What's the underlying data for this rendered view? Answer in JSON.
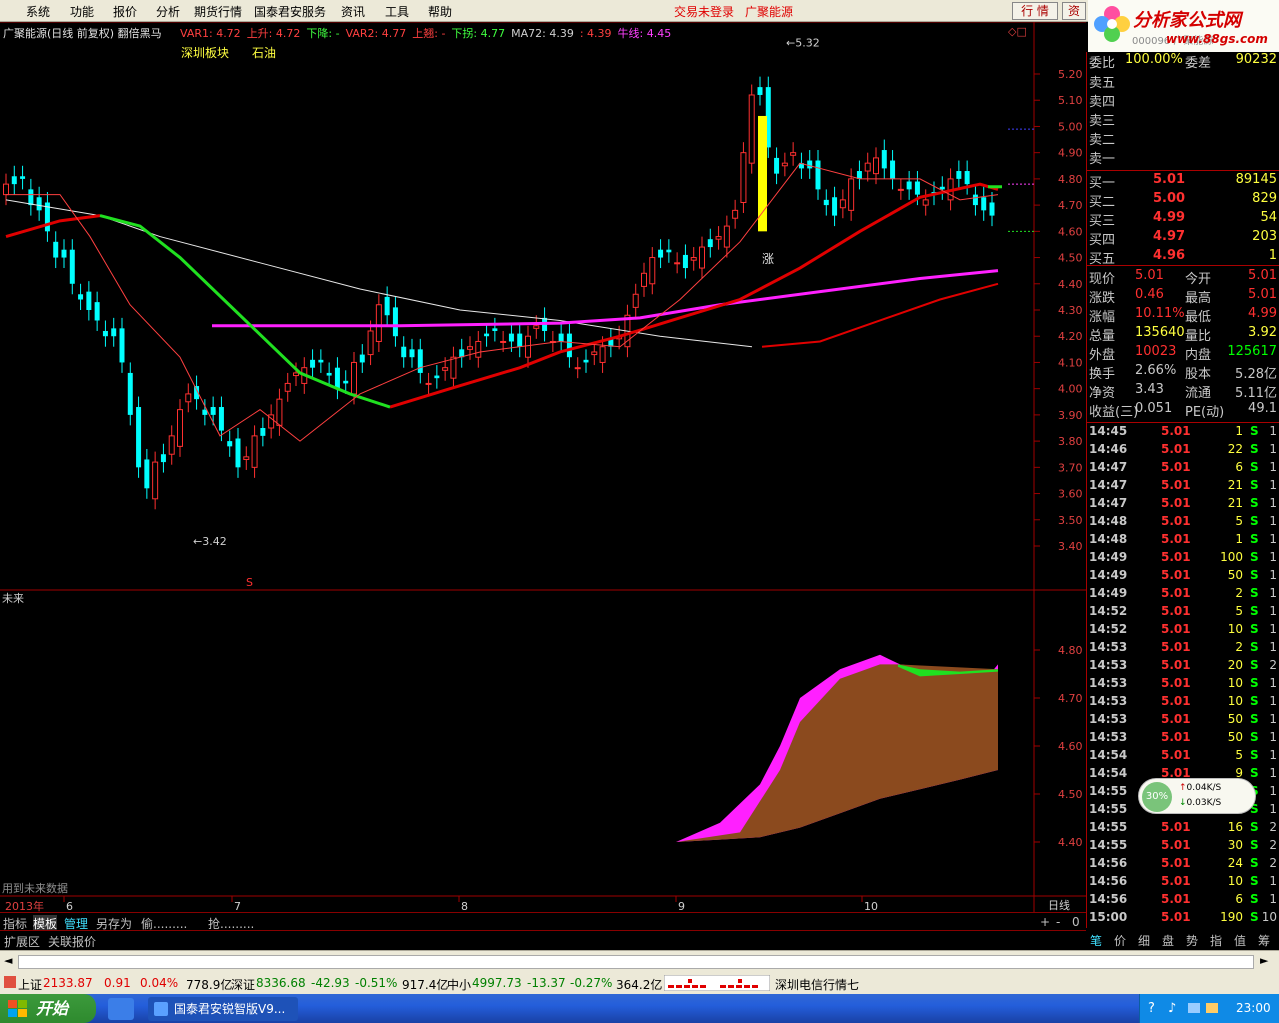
{
  "menu": {
    "items": [
      "系统",
      "功能",
      "报价",
      "分析",
      "期货行情",
      "国泰君安服务",
      "资讯",
      "工具",
      "帮助"
    ],
    "login_status": "交易未登录",
    "stock_link": "广聚能源",
    "btn_quote": "行 情",
    "btn_trade": "资"
  },
  "logo": {
    "title": "分析家公式网",
    "url_text": "www.88gs.com",
    "code_text": "000096 广聚能源"
  },
  "chart": {
    "header_title": "广聚能源(日线 前复权) 翻倍黑马",
    "legend": [
      {
        "label": "VAR1:",
        "value": "4.72",
        "color": "#ff4040"
      },
      {
        "label": "上升:",
        "value": "4.72",
        "color": "#ff4040"
      },
      {
        "label": "下降:",
        "value": "-",
        "color": "#40ff40"
      },
      {
        "label": "VAR2:",
        "value": "4.77",
        "color": "#ff4040"
      },
      {
        "label": "上翘:",
        "value": "-",
        "color": "#ff4040"
      },
      {
        "label": "下拐:",
        "value": "4.77",
        "color": "#40ff40"
      },
      {
        "label": "MA72:",
        "value": "4.39",
        "color": "#d0d0d0"
      },
      {
        "label": ":",
        "value": "4.39",
        "color": "#ff4040"
      },
      {
        "label": "牛线:",
        "value": "4.45",
        "color": "#ff40ff"
      }
    ],
    "tags": [
      "深圳板块",
      "石油"
    ],
    "high_label": "5.32",
    "low_label": "3.42",
    "zhang_label": "涨",
    "s_mark": "S",
    "sub_title": "未来",
    "future_note": "用到未来数据",
    "y_main": [
      "5.20",
      "5.10",
      "5.00",
      "4.90",
      "4.80",
      "4.70",
      "4.60",
      "4.50",
      "4.40",
      "4.30",
      "4.20",
      "4.10",
      "4.00",
      "3.90",
      "3.80",
      "3.70",
      "3.60",
      "3.50",
      "3.40"
    ],
    "y_sub": [
      "4.80",
      "4.70",
      "4.60",
      "4.50",
      "4.40"
    ],
    "x_labels": [
      "2013年",
      "6",
      "7",
      "8",
      "9",
      "10"
    ],
    "period_label": "日线"
  },
  "chart_data": {
    "type": "candlestick",
    "price_range": [
      3.4,
      5.32
    ],
    "high": 5.32,
    "low": 3.42,
    "ma72_last": 4.39,
    "bull_line_last": 4.45,
    "sub_range": [
      4.4,
      4.8
    ]
  },
  "bottom_tabs": [
    "指标",
    "模板",
    "管理",
    "另存为",
    "偷.........",
    "抢........."
  ],
  "ext_tabs": [
    "扩展区",
    "关联报价"
  ],
  "quote": {
    "weibi_label": "委比",
    "weibi": "100.00%",
    "weicha_label": "委差",
    "weicha": "90232",
    "sell": [
      {
        "l": "卖五"
      },
      {
        "l": "卖四"
      },
      {
        "l": "卖三"
      },
      {
        "l": "卖二"
      },
      {
        "l": "卖一"
      }
    ],
    "buy": [
      {
        "l": "买一",
        "p": "5.01",
        "v": "89145"
      },
      {
        "l": "买二",
        "p": "5.00",
        "v": "829"
      },
      {
        "l": "买三",
        "p": "4.99",
        "v": "54"
      },
      {
        "l": "买四",
        "p": "4.97",
        "v": "203"
      },
      {
        "l": "买五",
        "p": "4.96",
        "v": "1"
      }
    ],
    "stats": [
      {
        "a": "现价",
        "av": "5.01",
        "b": "今开",
        "bv": "5.01"
      },
      {
        "a": "涨跌",
        "av": "0.46",
        "b": "最高",
        "bv": "5.01"
      },
      {
        "a": "涨幅",
        "av": "10.11%",
        "b": "最低",
        "bv": "4.99"
      },
      {
        "a": "总量",
        "av": "135640",
        "b": "量比",
        "bv": "3.92"
      },
      {
        "a": "外盘",
        "av": "10023",
        "b": "内盘",
        "bv": "125617"
      },
      {
        "a": "换手",
        "av": "2.66%",
        "b": "股本",
        "bv": "5.28亿"
      },
      {
        "a": "净资",
        "av": "3.43",
        "b": "流通",
        "bv": "5.11亿"
      },
      {
        "a": "收益(三)",
        "av": "0.051",
        "b": "PE(动)",
        "bv": "49.1"
      }
    ],
    "ticks": [
      {
        "t": "14:45",
        "p": "5.01",
        "v": "1",
        "s": "S",
        "n": "1"
      },
      {
        "t": "14:46",
        "p": "5.01",
        "v": "22",
        "s": "S",
        "n": "1"
      },
      {
        "t": "14:47",
        "p": "5.01",
        "v": "6",
        "s": "S",
        "n": "1"
      },
      {
        "t": "14:47",
        "p": "5.01",
        "v": "21",
        "s": "S",
        "n": "1"
      },
      {
        "t": "14:47",
        "p": "5.01",
        "v": "21",
        "s": "S",
        "n": "1"
      },
      {
        "t": "14:48",
        "p": "5.01",
        "v": "5",
        "s": "S",
        "n": "1"
      },
      {
        "t": "14:48",
        "p": "5.01",
        "v": "1",
        "s": "S",
        "n": "1"
      },
      {
        "t": "14:49",
        "p": "5.01",
        "v": "100",
        "s": "S",
        "n": "1"
      },
      {
        "t": "14:49",
        "p": "5.01",
        "v": "50",
        "s": "S",
        "n": "1"
      },
      {
        "t": "14:49",
        "p": "5.01",
        "v": "2",
        "s": "S",
        "n": "1"
      },
      {
        "t": "14:52",
        "p": "5.01",
        "v": "5",
        "s": "S",
        "n": "1"
      },
      {
        "t": "14:52",
        "p": "5.01",
        "v": "10",
        "s": "S",
        "n": "1"
      },
      {
        "t": "14:53",
        "p": "5.01",
        "v": "2",
        "s": "S",
        "n": "1"
      },
      {
        "t": "14:53",
        "p": "5.01",
        "v": "20",
        "s": "S",
        "n": "2"
      },
      {
        "t": "14:53",
        "p": "5.01",
        "v": "10",
        "s": "S",
        "n": "1"
      },
      {
        "t": "14:53",
        "p": "5.01",
        "v": "10",
        "s": "S",
        "n": "1"
      },
      {
        "t": "14:53",
        "p": "5.01",
        "v": "50",
        "s": "S",
        "n": "1"
      },
      {
        "t": "14:53",
        "p": "5.01",
        "v": "50",
        "s": "S",
        "n": "1"
      },
      {
        "t": "14:54",
        "p": "5.01",
        "v": "5",
        "s": "S",
        "n": "1"
      },
      {
        "t": "14:54",
        "p": "5.01",
        "v": "9",
        "s": "S",
        "n": "1"
      },
      {
        "t": "14:55",
        "p": "5.01",
        "v": "",
        "s": "S",
        "n": "1"
      },
      {
        "t": "14:55",
        "p": "5.01",
        "v": "",
        "s": "S",
        "n": "1"
      },
      {
        "t": "14:55",
        "p": "5.01",
        "v": "16",
        "s": "S",
        "n": "2"
      },
      {
        "t": "14:55",
        "p": "5.01",
        "v": "30",
        "s": "S",
        "n": "2"
      },
      {
        "t": "14:56",
        "p": "5.01",
        "v": "24",
        "s": "S",
        "n": "2"
      },
      {
        "t": "14:56",
        "p": "5.01",
        "v": "10",
        "s": "S",
        "n": "1"
      },
      {
        "t": "14:56",
        "p": "5.01",
        "v": "6",
        "s": "S",
        "n": "1"
      },
      {
        "t": "15:00",
        "p": "5.01",
        "v": "190",
        "s": "S",
        "n": "10"
      }
    ],
    "tabs": [
      "笔",
      "价",
      "细",
      "盘",
      "势",
      "指",
      "值",
      "筹"
    ]
  },
  "net": {
    "pct": "30%",
    "up": "0.04K/S",
    "down": "0.03K/S"
  },
  "index_bar": {
    "sh_label": "上证",
    "sh": "2133.87",
    "sh_chg": "0.91",
    "sh_pct": "0.04%",
    "sh_amt": "778.9亿",
    "sz_label": "深证",
    "sz": "8336.68",
    "sz_chg": "-42.93",
    "sz_pct": "-0.51%",
    "sz_amt": "917.4亿",
    "zx_label": "中小",
    "zx": "4997.73",
    "zx_chg": "-13.37",
    "zx_pct": "-0.27%",
    "zx_amt": "364.2亿",
    "ticker": "深圳电信行情七"
  },
  "taskbar": {
    "start": "开始",
    "app": "国泰君安锐智版V9...",
    "time": "23:00"
  },
  "colors": {
    "up": "#ff3030",
    "down": "#00ffff",
    "ma_red": "#e00000",
    "bull": "#ff00ff",
    "green": "#00ff00",
    "quote_yellow": "#ffff00"
  }
}
